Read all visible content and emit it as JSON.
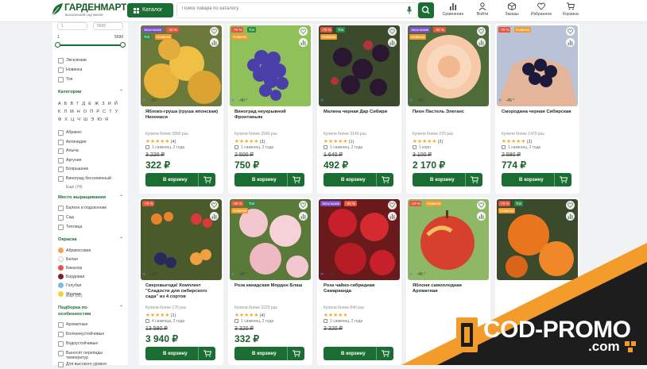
{
  "header": {
    "logo_name": "ГАРДЕНМАРТ",
    "logo_tagline": "высшееший сад жизни",
    "catalog_label": "Каталог",
    "search_placeholder": "Поиск товара по каталогу",
    "nav": [
      {
        "label": "Сравнение",
        "icon": "bar-chart-icon"
      },
      {
        "label": "Войти",
        "icon": "user-icon"
      },
      {
        "label": "Заказы",
        "icon": "box-icon"
      },
      {
        "label": "Избранное",
        "icon": "heart-icon"
      },
      {
        "label": "Корзина",
        "icon": "cart-icon"
      }
    ]
  },
  "sidebar": {
    "price_from": "1",
    "price_to": "5690",
    "range_min": "1",
    "range_max": "5690",
    "flags": [
      "Эксклюзив",
      "Новинка",
      "Топ"
    ],
    "categories_title": "Категории",
    "letters": "А Б В Г Д Е Ж З И Й К Л М Н О П Р С Т У Ф Х Ц Ч Ш Э Ю Я",
    "categories": [
      "Абрикос",
      "Актинидия",
      "Алыча",
      "Аргуния",
      "Боярышник",
      "Виноград бессемянный"
    ],
    "categories_more": "Ещё (74)",
    "place_title": "Место выращивания",
    "places": [
      "Балкон и подоконник",
      "Сад",
      "Теплица"
    ],
    "color_title": "Окраска",
    "colors": [
      {
        "label": "Абрикосовая",
        "color": "#f4a259"
      },
      {
        "label": "Белая",
        "color": "#ffffff"
      },
      {
        "label": "Бикалор",
        "color": "#e0564f"
      },
      {
        "label": "Бордовая",
        "color": "#7a1f2b"
      },
      {
        "label": "Голубая",
        "color": "#7fb7e6"
      },
      {
        "label": "Желтая",
        "color": "#f2d33b"
      }
    ],
    "colors_more": "Ещё (32)",
    "features_title": "Подборка по особенностям",
    "features": [
      "Ароматные",
      "Болезнеустойчивые",
      "Водоустойчивые",
      "Выносят перепады температур",
      "Для высокого уровня"
    ]
  },
  "products": [
    {
      "title": "Яблоко-груша (груша японская) Нихонаси",
      "badges": [
        {
          "t": "Эксклюзив",
          "c": "#7b4fc9"
        },
        {
          "t": "-10 %",
          "c": "#e8573d"
        },
        {
          "t": "Топ",
          "c": "#2a8c4a"
        },
        {
          "t": "Новинка",
          "c": "#f39b2b"
        }
      ],
      "zone": "-30 °",
      "bought": "Купили более 2890 раз",
      "rating": "(4)",
      "stock": "1 саженец, 2 года",
      "old": "3 220 ₽",
      "price": "322 ₽",
      "cart": "В корзину"
    },
    {
      "title": "Виноград неукрывной Фронтиньяк",
      "badges": [
        {
          "t": "-70 %",
          "c": "#e8573d"
        },
        {
          "t": "Топ",
          "c": "#2a8c4a"
        },
        {
          "t": "Новинка",
          "c": "#f39b2b"
        }
      ],
      "zone": "-40 °",
      "bought": "Купили более 2540 раз",
      "rating": "(3)",
      "stock": "1 саженец, 2 года",
      "old": "2 500 ₽",
      "price": "750 ₽",
      "cart": "В корзину"
    },
    {
      "title": "Малина черная Дар Сибири",
      "badges": [
        {
          "t": "-70 %",
          "c": "#e8573d"
        },
        {
          "t": "Топ",
          "c": "#2a8c4a"
        },
        {
          "t": "Новинка",
          "c": "#f39b2b"
        }
      ],
      "zone": "-40 °",
      "bought": "Купили более 3140 раз",
      "rating": "(1)",
      "stock": "1 саженец, 2 года",
      "old": "1 640 ₽",
      "price": "492 ₽",
      "cart": "В корзину"
    },
    {
      "title": "Пион Пастель Элеганс",
      "badges": [
        {
          "t": "Эксклюзив",
          "c": "#7b4fc9"
        },
        {
          "t": "-30 %",
          "c": "#e8573d"
        },
        {
          "t": "Новинка",
          "c": "#f39b2b"
        }
      ],
      "zone": "-40 °",
      "bought": "Купили более 270 раз",
      "rating": "(2)",
      "stock": "1 корн",
      "old": "3 100 ₽",
      "price": "2 170 ₽",
      "cart": "В корзину"
    },
    {
      "title": "Смородина черная Сибирская",
      "badges": [
        {
          "t": "-70 %",
          "c": "#e8573d"
        },
        {
          "t": "Новинка",
          "c": "#f39b2b"
        }
      ],
      "zone": "-45 °",
      "bought": "Купили более 1470 раз",
      "rating": "(2)",
      "stock": "1 саженец, 2 года",
      "old": "2 580 ₽",
      "price": "774 ₽",
      "cart": "В корзину"
    },
    {
      "title": "Сверхвыгода! Комплект \"Сладости для сибирского сада\" из 4 сортов",
      "badges": [
        {
          "t": "-70 %",
          "c": "#e8573d"
        }
      ],
      "zone": "-40 °",
      "bought": "Купили более 170 раз",
      "rating": "(1)",
      "stock": "4 саженца, 2 года",
      "old": "13 580 ₽",
      "price": "3 940 ₽",
      "cart": "В корзину"
    },
    {
      "title": "Роза канадская Морден Блаш",
      "badges": [
        {
          "t": "-90 %",
          "c": "#e8573d"
        },
        {
          "t": "Топ",
          "c": "#2a8c4a"
        },
        {
          "t": "Новинка",
          "c": "#f39b2b"
        }
      ],
      "zone": "-45 °",
      "bought": "Купили более 3220 раз",
      "rating": "(4)",
      "stock": "1 саженец, 2 года",
      "old": "3 320 ₽",
      "price": "332 ₽",
      "cart": "В корзину"
    },
    {
      "title": "Роза чайно-гибридная Самарканда",
      "badges": [
        {
          "t": "Эксклюзив",
          "c": "#7b4fc9"
        },
        {
          "t": "-90 %",
          "c": "#e8573d"
        }
      ],
      "zone": "-30 °",
      "bought": "Купили более 840 раз",
      "rating": "",
      "stock": "1 саженец, 2 года",
      "old": "3 320 ₽",
      "price": "",
      "cart": "В корзину"
    },
    {
      "title": "Яблоня самоплодная Ароматная",
      "badges": [
        {
          "t": "-10 %",
          "c": "#e8573d"
        },
        {
          "t": "Новинка",
          "c": "#f39b2b"
        }
      ],
      "zone": "-45 °",
      "bought": "",
      "rating": "",
      "stock": "",
      "old": "",
      "price": "",
      "cart": ""
    },
    {
      "title": "",
      "badges": [
        {
          "t": "-70 %",
          "c": "#e8573d"
        },
        {
          "t": "Топ",
          "c": "#2a8c4a"
        },
        {
          "t": "Новинка",
          "c": "#f39b2b"
        }
      ],
      "zone": "",
      "bought": "",
      "rating": "",
      "stock": "",
      "old": "",
      "price": "",
      "cart": ""
    }
  ],
  "watermark": {
    "line1": "COD-PROMO",
    "line2": ".com"
  }
}
